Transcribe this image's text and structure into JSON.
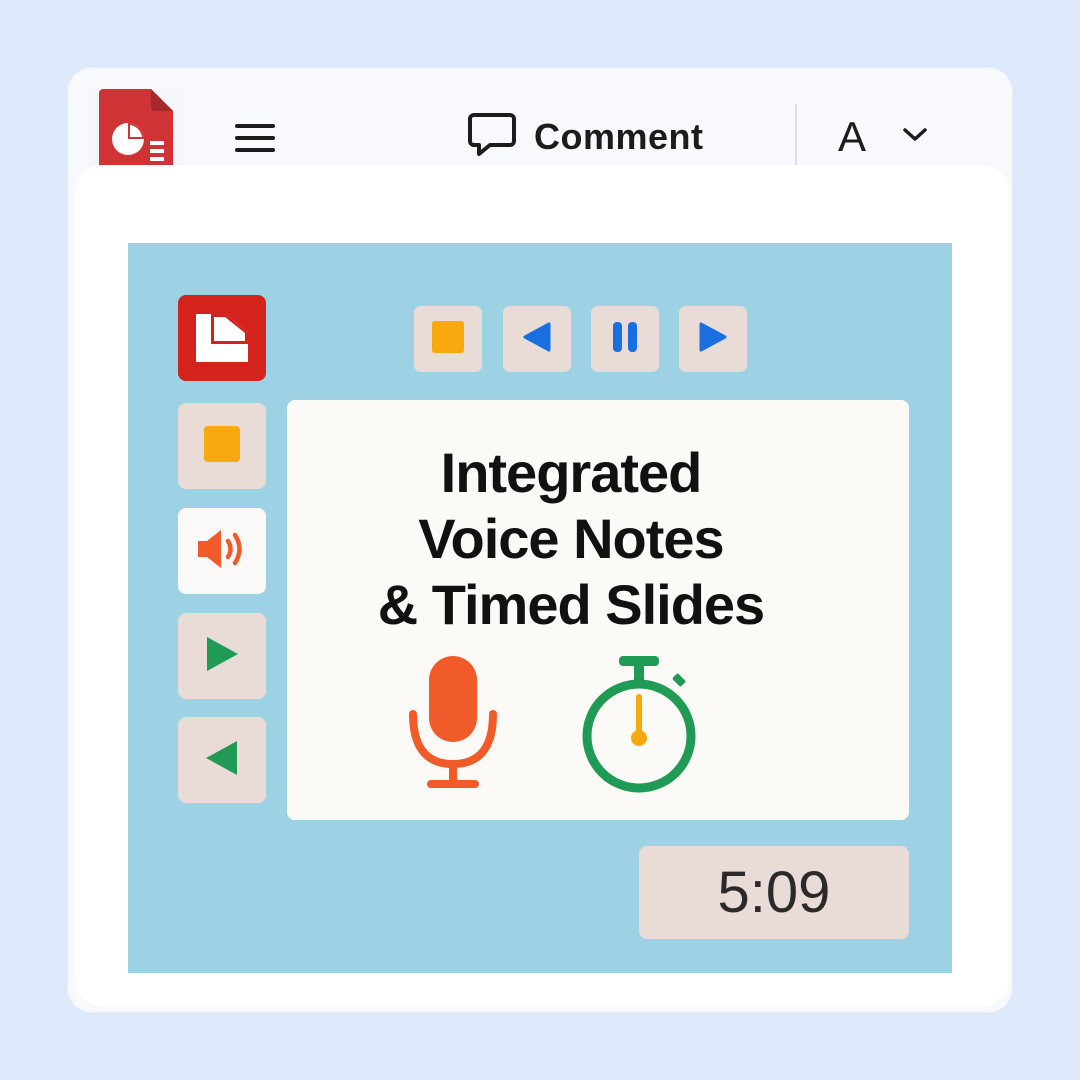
{
  "toolbar": {
    "app_icon": "presentation-app-icon",
    "menu_icon": "hamburger-menu-icon",
    "comment_icon": "speech-bubble-icon",
    "comment_label": "Comment",
    "font_label": "A",
    "font_dropdown_icon": "chevron-down-icon"
  },
  "side_controls": [
    {
      "name": "slides-logo",
      "icon": "slides-logo-icon"
    },
    {
      "name": "stop",
      "icon": "stop-square-icon",
      "color": "#f7a90f"
    },
    {
      "name": "audio",
      "icon": "speaker-icon",
      "color": "#f15a29"
    },
    {
      "name": "play",
      "icon": "play-icon",
      "color": "#1f9b55"
    },
    {
      "name": "rewind",
      "icon": "reverse-play-icon",
      "color": "#1f9b55"
    }
  ],
  "top_controls": [
    {
      "name": "stop",
      "icon": "stop-square-icon",
      "color": "#f7a90f"
    },
    {
      "name": "previous",
      "icon": "previous-triangle-icon",
      "color": "#1a6fe0"
    },
    {
      "name": "pause",
      "icon": "pause-icon",
      "color": "#1a6fe0"
    },
    {
      "name": "next",
      "icon": "next-triangle-icon",
      "color": "#1a6fe0"
    }
  ],
  "slide": {
    "title_lines": [
      "Integrated",
      "Voice Notes",
      "& Timed Slides"
    ],
    "mic_icon": "microphone-icon",
    "stopwatch_icon": "stopwatch-icon"
  },
  "timer": {
    "value": "5:09"
  },
  "colors": {
    "background": "#dde9fb",
    "slide_area": "#9dd2e5",
    "button_fill": "#e9dcd6",
    "brand_red": "#d4221d",
    "orange": "#f15a29",
    "green": "#1f9b55",
    "blue": "#1a6fe0",
    "amber": "#f7a90f"
  }
}
